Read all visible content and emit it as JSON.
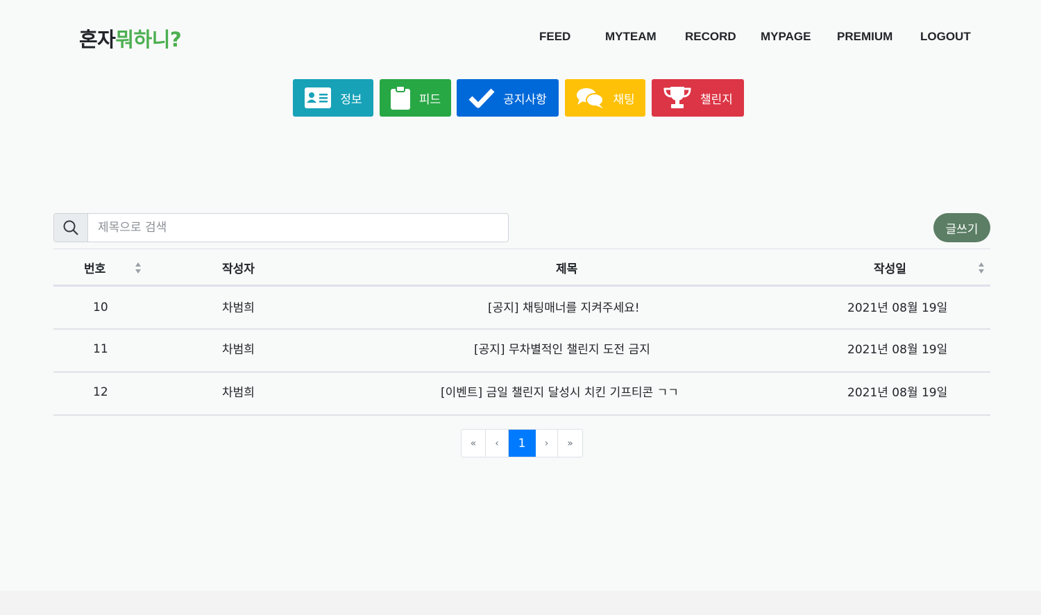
{
  "logo": {
    "part1": "혼자",
    "part2": "뭐하니?"
  },
  "nav": [
    "FEED",
    "MYTEAM",
    "RECORD",
    "MYPAGE",
    "PREMIUM",
    "LOGOUT"
  ],
  "tabs": [
    {
      "label": "정보",
      "icon": "id-card-icon",
      "color": "#17a2b8"
    },
    {
      "label": "피드",
      "icon": "clipboard-icon",
      "color": "#28a745"
    },
    {
      "label": "공지사항",
      "icon": "check-icon",
      "color": "#0069d9"
    },
    {
      "label": "채팅",
      "icon": "chat-bubbles-icon",
      "color": "#ffc107"
    },
    {
      "label": "챌린지",
      "icon": "trophy-icon",
      "color": "#dc3545"
    }
  ],
  "search": {
    "placeholder": "제목으로 검색",
    "value": ""
  },
  "write_button": "글쓰기",
  "table": {
    "headers": [
      "번호",
      "작성자",
      "제목",
      "작성일"
    ],
    "rows": [
      [
        "10",
        "차범희",
        "[공지] 채팅매너를 지켜주세요!",
        "2021년 08월 19일"
      ],
      [
        "11",
        "차범희",
        "[공지] 무차별적인 챌린지 도전 금지",
        "2021년 08월 19일"
      ],
      [
        "12",
        "차범희",
        "[이벤트] 금일 챌린지 달성시 치킨 기프티콘 ㄱㄱ",
        "2021년 08월 19일"
      ]
    ]
  },
  "pagination": {
    "first": "«",
    "prev": "‹",
    "current": "1",
    "next": "›",
    "last": "»"
  }
}
